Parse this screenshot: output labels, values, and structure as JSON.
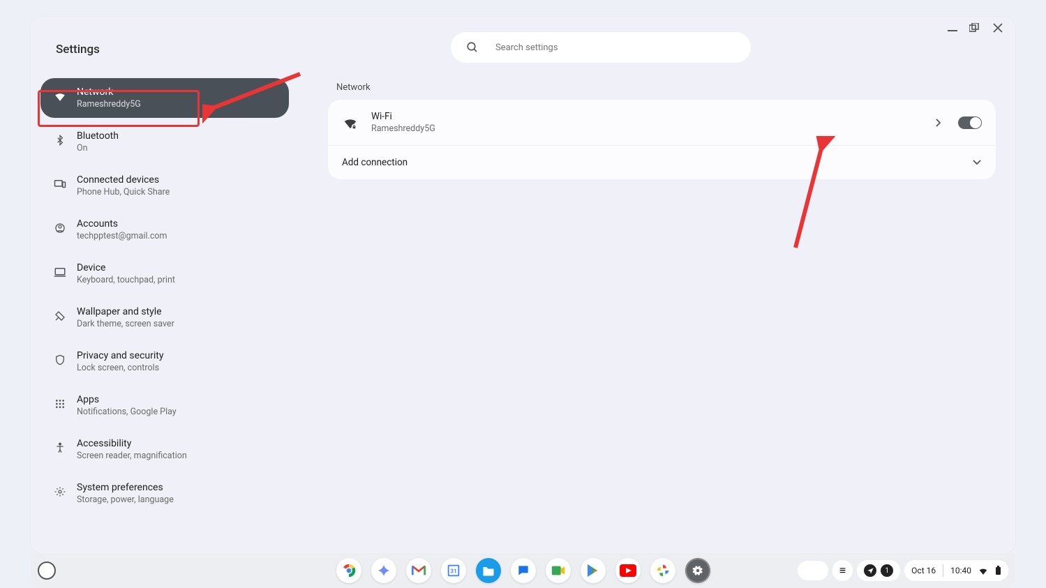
{
  "window": {
    "title": "Settings",
    "search_placeholder": "Search settings"
  },
  "sidebar": {
    "items": [
      {
        "label": "Network",
        "sub": "Rameshreddy5G",
        "icon": "wifi",
        "selected": true
      },
      {
        "label": "Bluetooth",
        "sub": "On",
        "icon": "bluetooth"
      },
      {
        "label": "Connected devices",
        "sub": "Phone Hub, Quick Share",
        "icon": "devices"
      },
      {
        "label": "Accounts",
        "sub": "techpptest@gmail.com",
        "icon": "account"
      },
      {
        "label": "Device",
        "sub": "Keyboard, touchpad, print",
        "icon": "laptop"
      },
      {
        "label": "Wallpaper and style",
        "sub": "Dark theme, screen saver",
        "icon": "design"
      },
      {
        "label": "Privacy and security",
        "sub": "Lock screen, controls",
        "icon": "shield"
      },
      {
        "label": "Apps",
        "sub": "Notifications, Google Play",
        "icon": "grid"
      },
      {
        "label": "Accessibility",
        "sub": "Screen reader, magnification",
        "icon": "access"
      },
      {
        "label": "System preferences",
        "sub": "Storage, power, language",
        "icon": "gear"
      }
    ]
  },
  "main": {
    "section_title": "Network",
    "wifi": {
      "label": "Wi-Fi",
      "ssid": "Rameshreddy5G",
      "enabled": true
    },
    "add_connection_label": "Add connection"
  },
  "shelf": {
    "apps": [
      {
        "name": "chrome"
      },
      {
        "name": "gemini"
      },
      {
        "name": "gmail"
      },
      {
        "name": "calendar"
      },
      {
        "name": "files"
      },
      {
        "name": "messages"
      },
      {
        "name": "meet"
      },
      {
        "name": "play"
      },
      {
        "name": "youtube"
      },
      {
        "name": "photos"
      },
      {
        "name": "settings",
        "active": true
      }
    ],
    "notifications_count": "1",
    "date": "Oct 16",
    "time": "10:40"
  }
}
